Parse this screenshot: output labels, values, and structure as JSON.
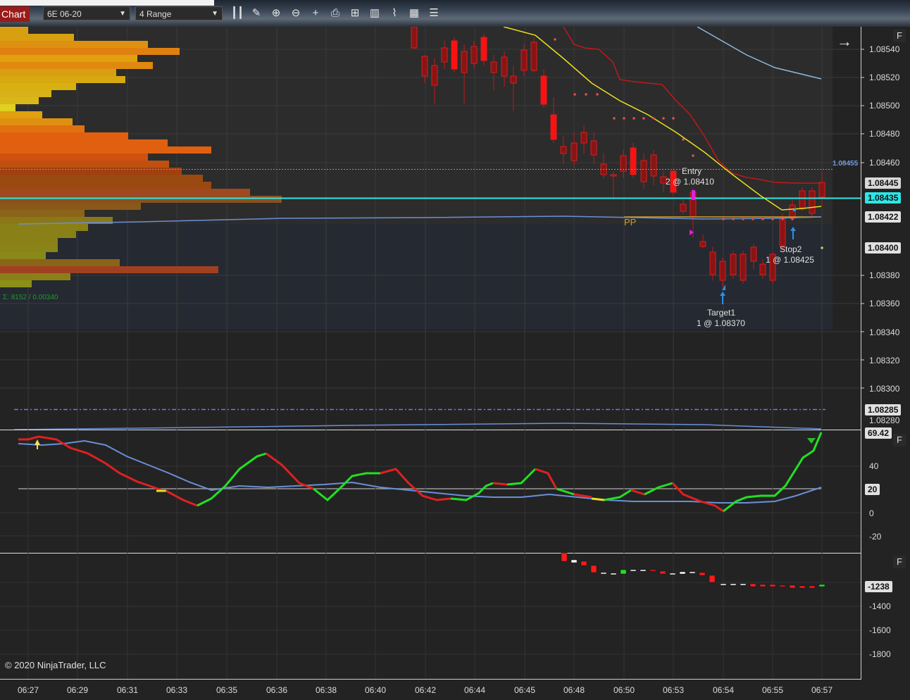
{
  "toolbar": {
    "chart_tab": "Chart",
    "instrument": "6E 06-20",
    "bar_type": "4 Range",
    "icons": [
      "bar-type-icon",
      "draw-icon",
      "zoom-in-icon",
      "zoom-out-icon",
      "crosshair-icon",
      "properties-icon",
      "indicators-icon",
      "strategies-icon",
      "templates-icon",
      "more-icon"
    ]
  },
  "price_axis": {
    "ticks": [
      "1.08540",
      "1.08520",
      "1.08500",
      "1.08480",
      "1.08460",
      "1.08360",
      "1.08340",
      "1.08320",
      "1.08300",
      "1.08280",
      "1.08380"
    ],
    "tag_top": "1.08455",
    "tag_last": "1.08445",
    "tag_cyan": "1.08435",
    "tag_pivot": "1.08422",
    "tag_stop": "1.08400",
    "tag_low": "1.08285",
    "cut_label": "1.08280"
  },
  "osc_axis": {
    "ticks": [
      "40",
      "0",
      "-20"
    ],
    "tag_value": "69.42",
    "tag_level": "20"
  },
  "cum_axis": {
    "ticks": [
      "-1400",
      "-1600",
      "-1800"
    ],
    "tag_value": "-1238"
  },
  "time_axis": [
    "06:27",
    "06:29",
    "06:31",
    "06:33",
    "06:35",
    "06:36",
    "06:38",
    "06:40",
    "06:42",
    "06:44",
    "06:45",
    "06:48",
    "06:50",
    "06:53",
    "06:54",
    "06:55",
    "06:57"
  ],
  "orders": {
    "entry_name": "Entry",
    "entry_qty": "2 @ 1.08410",
    "stop_name": "Stop2",
    "stop_qty": "1 @ 1.08425",
    "target_name": "Target1",
    "target_qty": "1 @ 1.08370"
  },
  "pivot_label": "PP",
  "volume_profile_label": "Σ: 8152 / 0.00340",
  "copyright": "© 2020 NinjaTrader, LLC",
  "panel_button": "F",
  "colors": {
    "background": "#232323",
    "bear_candle": "#d42020",
    "cyan_line": "#2ee6e6",
    "sma_yellow": "#e8e020",
    "osc_green": "#22e022",
    "osc_red": "#e02020",
    "osc_blue": "#6a8fd8"
  }
}
